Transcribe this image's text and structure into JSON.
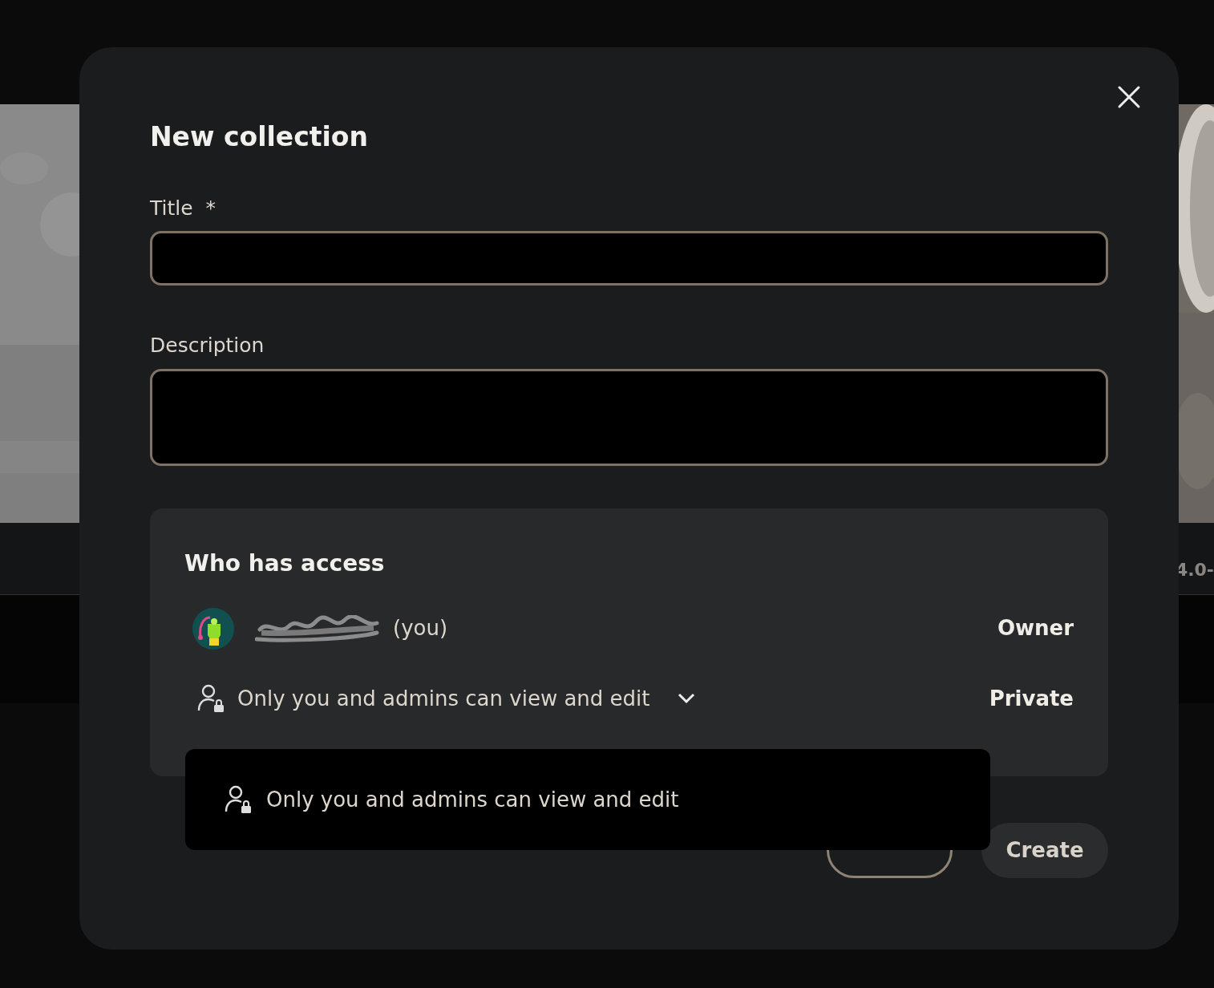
{
  "background": {
    "side_text": "4.0-"
  },
  "dialog": {
    "title": "New collection",
    "fields": [
      {
        "label": "Title",
        "required_mark": "*",
        "kind": "input"
      },
      {
        "label": "Description",
        "kind": "textarea"
      }
    ],
    "access": {
      "heading": "Who has access",
      "members": [
        {
          "suffix": "(you)",
          "role": "Owner"
        }
      ],
      "visibility": {
        "value": "Only you and admins can view and edit",
        "label": "Private",
        "expanded": true
      },
      "menu": [
        {
          "label": "Only you and admins can view and edit"
        }
      ]
    },
    "buttons": [
      {
        "kind": "outline"
      },
      {
        "label": "Create",
        "kind": "filled"
      }
    ]
  }
}
